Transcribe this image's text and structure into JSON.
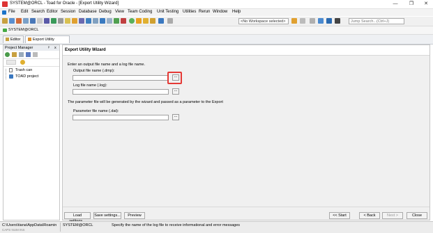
{
  "window": {
    "title": "SYSTEM@ORCL - Toad for Oracle - [Export Utility Wizard]",
    "min_glyph": "—",
    "restore_glyph": "❐",
    "close_glyph": "✕"
  },
  "menu": [
    "File",
    "Edit",
    "Search",
    "Editor",
    "Session",
    "Database",
    "Debug",
    "View",
    "Team Coding",
    "Unit Testing",
    "Utilities",
    "Rerun",
    "Window",
    "Help"
  ],
  "toolbar": {
    "workspace_select": "<No Workspace selected>",
    "jump_search_placeholder": "Jump Search...(Ctrl+J)"
  },
  "connection_bar": {
    "connection": "SYSTEM@ORCL"
  },
  "doc_tabs": [
    {
      "label": "Editor"
    },
    {
      "label": "Export Utility Wizard"
    }
  ],
  "project_manager": {
    "title": "Project Manager",
    "pin": "ᵖ",
    "close": "x",
    "tree": [
      "Trash can",
      "TOAD project"
    ]
  },
  "wizard": {
    "header": "Export Utility Wizard",
    "intro": "Enter an output file name and a log file name.",
    "output_label": "Output file name (.dmp):",
    "log_label": "Log file name (.log):",
    "param_note": "The parameter file will be generated by the wizard and passed as a parameter to the Export",
    "param_label": "Parameter file name (.dat):",
    "output_value": "",
    "log_value": "",
    "param_value": "",
    "browse_label": "...",
    "buttons": {
      "load": "Load settings...",
      "save": "Save settings...",
      "preview": "Preview",
      "start": "<< Start",
      "back": "< Back",
      "next": "Next >",
      "close": "Close"
    },
    "highlight_color": "#e53935"
  },
  "status": {
    "path": "C:\\Users\\tiana\\AppData\\Roamin",
    "connection": "SYSTEM@ORCL",
    "hint": "Specify the name of the log file to receive informational and error messages",
    "sub_left": "CAPS  NUM  INS"
  }
}
